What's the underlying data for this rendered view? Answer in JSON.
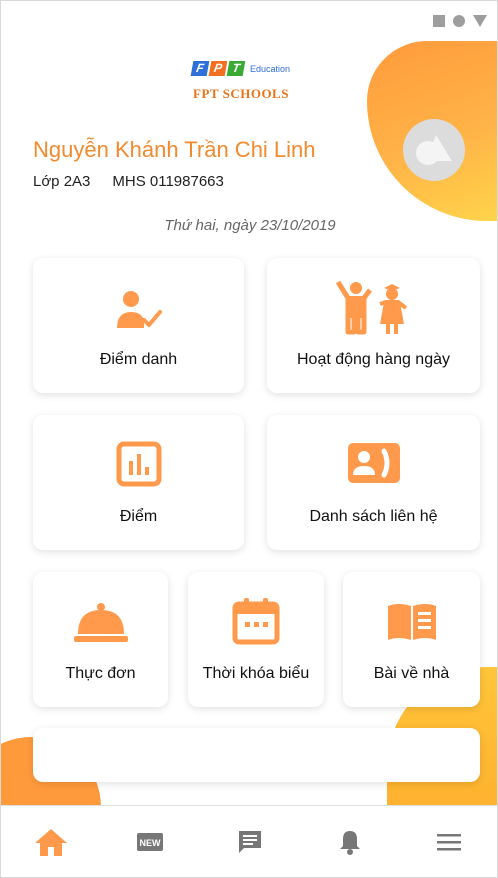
{
  "status_bar": {
    "icons": [
      "square-icon",
      "circle-icon",
      "triangle-icon"
    ]
  },
  "logo": {
    "brand": "FPT",
    "sub": "Education",
    "school": "FPT SCHOOLS"
  },
  "student": {
    "name": "Nguyễn Khánh Trần Chi Linh",
    "class": "Lớp 2A3",
    "id": "MHS 011987663"
  },
  "date": "Thứ hai, ngày 23/10/2019",
  "menu": [
    {
      "label": "Điểm danh",
      "icon": "attendance-icon"
    },
    {
      "label": "Hoạt động hàng ngày",
      "icon": "kids-activity-icon"
    },
    {
      "label": "Điểm",
      "icon": "chart-icon"
    },
    {
      "label": "Danh sách liên hệ",
      "icon": "contact-icon"
    },
    {
      "label": "Thực đơn",
      "icon": "food-cloche-icon"
    },
    {
      "label": "Thời khóa biểu",
      "icon": "calendar-icon"
    },
    {
      "label": "Bài về nhà",
      "icon": "book-icon"
    }
  ],
  "nav": [
    {
      "icon": "home-icon",
      "active": true
    },
    {
      "icon": "new-icon",
      "text": "NEW"
    },
    {
      "icon": "message-icon"
    },
    {
      "icon": "bell-icon"
    },
    {
      "icon": "menu-icon"
    }
  ],
  "colors": {
    "accent": "#f28a2e",
    "icon": "#ff9a4d",
    "muted": "#666666"
  }
}
